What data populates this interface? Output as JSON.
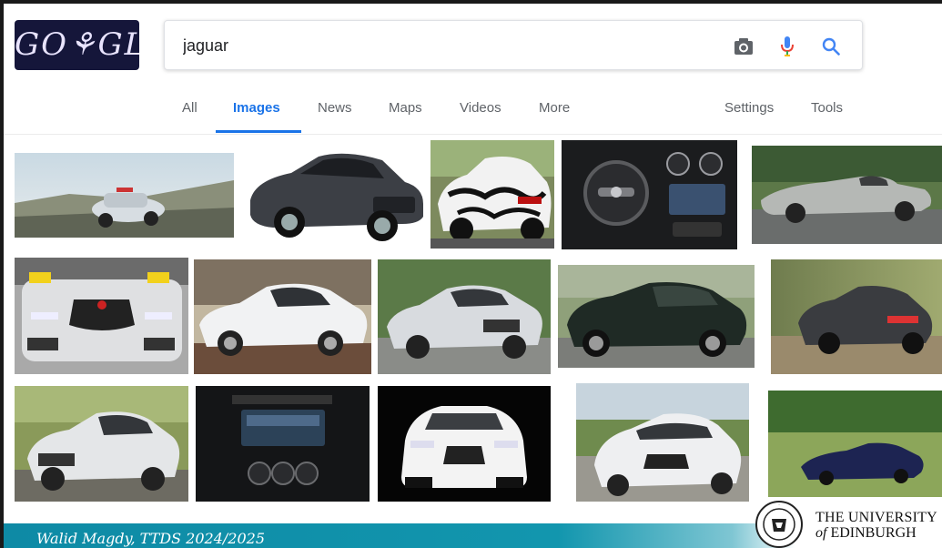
{
  "logo": {
    "text": "GO⚘GLE"
  },
  "search": {
    "query": "jaguar"
  },
  "icons": {
    "camera": "camera-icon",
    "microphone": "microphone-icon",
    "search": "search-icon"
  },
  "colors": {
    "accent": "#1a73e8",
    "footer": "#1296ae",
    "mic_blue": "#4285f4",
    "mic_red": "#ea4335"
  },
  "tabs": {
    "all": "All",
    "images": "Images",
    "news": "News",
    "maps": "Maps",
    "videos": "Videos",
    "more": "More",
    "settings": "Settings",
    "tools": "Tools"
  },
  "footer": {
    "credit": "Walid Magdy, TTDS 2024/2025",
    "university_line1": "THE UNIVERSITY",
    "university_of": "of",
    "university_line2": "EDINBURGH"
  }
}
